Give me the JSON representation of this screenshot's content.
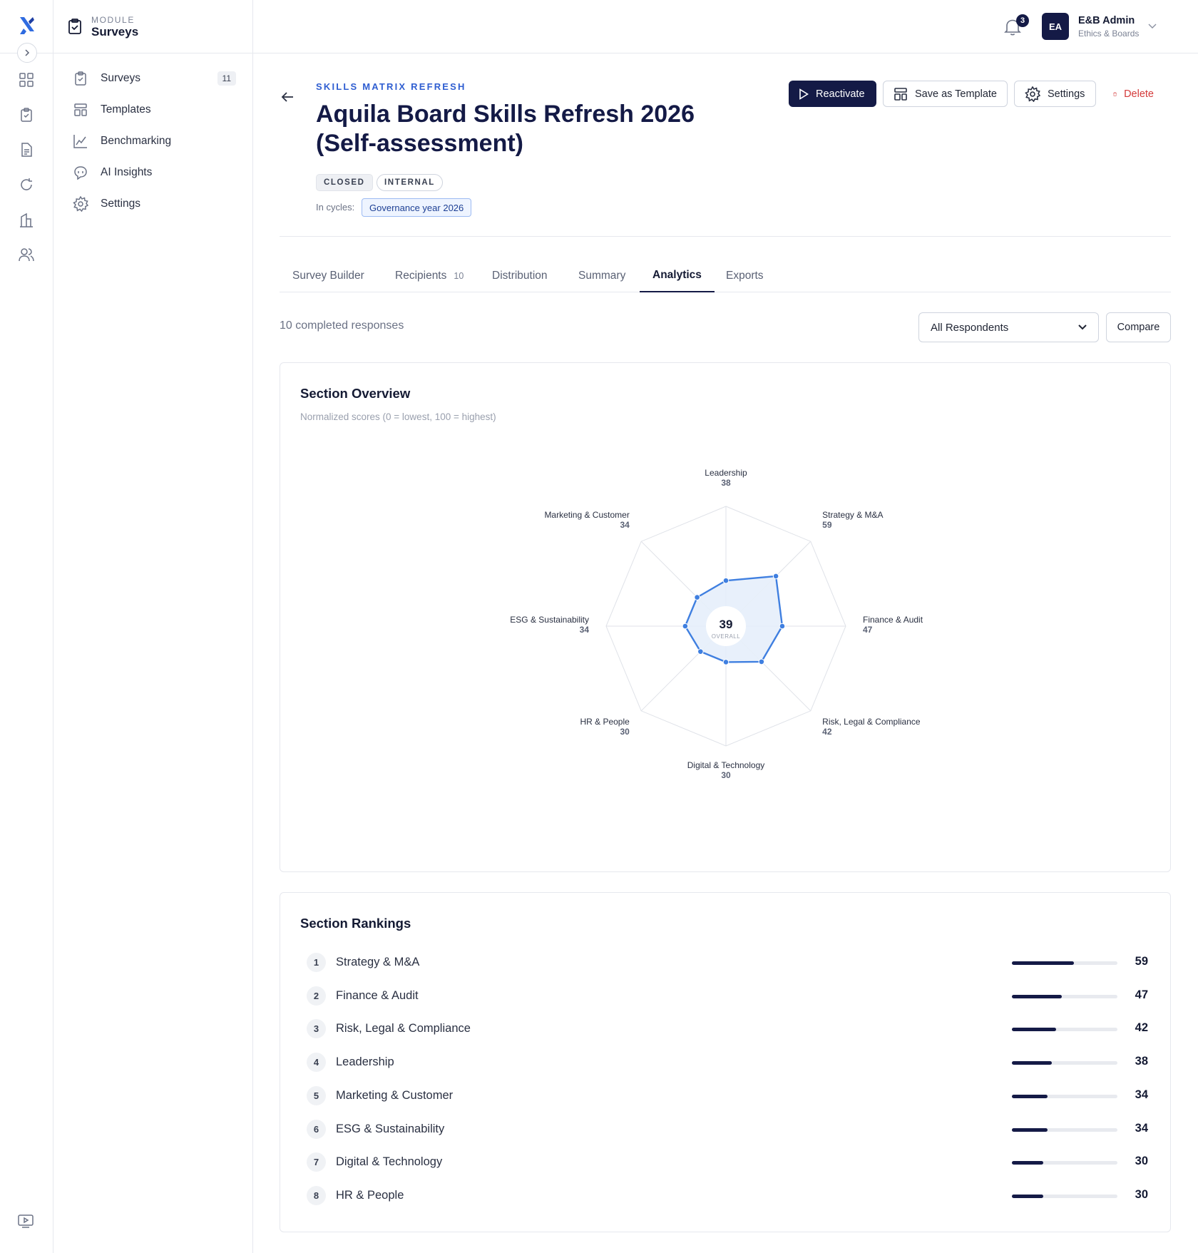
{
  "module": {
    "label": "MODULE",
    "title": "Surveys"
  },
  "rail": {
    "icons": [
      "logo-icon",
      "grid-icon",
      "clipboard-icon",
      "document-icon",
      "refresh-icon",
      "building-icon",
      "users-icon",
      "video-icon"
    ]
  },
  "sidebar": {
    "items": [
      {
        "label": "Surveys",
        "badge": "11",
        "icon": "clipboard-icon"
      },
      {
        "label": "Templates",
        "icon": "template-icon"
      },
      {
        "label": "Benchmarking",
        "icon": "chart-icon"
      },
      {
        "label": "AI Insights",
        "icon": "ai-icon"
      },
      {
        "label": "Settings",
        "icon": "gear-icon"
      }
    ]
  },
  "header": {
    "notifications": "3",
    "user": {
      "initials": "EA",
      "name": "E&B Admin",
      "org": "Ethics & Boards"
    }
  },
  "survey": {
    "eyebrow": "SKILLS MATRIX REFRESH",
    "title": "Aquila Board Skills Refresh 2026 (Self-assessment)",
    "status": "CLOSED",
    "visibility": "INTERNAL",
    "cycles_label": "In cycles:",
    "cycle": "Governance year 2026"
  },
  "actions": {
    "reactivate": "Reactivate",
    "save_template": "Save as Template",
    "settings": "Settings",
    "delete": "Delete"
  },
  "tabs": [
    {
      "label": "Survey Builder"
    },
    {
      "label": "Recipients",
      "count": "10"
    },
    {
      "label": "Distribution"
    },
    {
      "label": "Summary"
    },
    {
      "label": "Analytics",
      "active": true
    },
    {
      "label": "Exports"
    }
  ],
  "analytics": {
    "responses": "10 completed responses",
    "filter": "All Respondents",
    "compare": "Compare"
  },
  "overview": {
    "title": "Section Overview",
    "subtitle": "Normalized scores (0 = lowest, 100 = highest)",
    "overall_value": "39",
    "overall_label": "OVERALL"
  },
  "chart_data": {
    "type": "radar",
    "title": "Section Overview",
    "range": [
      0,
      100
    ],
    "categories": [
      "Leadership",
      "Strategy & M&A",
      "Finance & Audit",
      "Risk, Legal & Compliance",
      "Digital & Technology",
      "HR & People",
      "ESG & Sustainability",
      "Marketing & Customer"
    ],
    "values": [
      38,
      59,
      47,
      42,
      30,
      30,
      34,
      34
    ],
    "overall": 39,
    "colors": {
      "line": "#3f7fe0",
      "fill": "#e6eefb",
      "grid": "#dfe2e8"
    }
  },
  "rankings": {
    "title": "Section Rankings",
    "rows": [
      {
        "rank": "1",
        "name": "Strategy & M&A",
        "value": "59"
      },
      {
        "rank": "2",
        "name": "Finance & Audit",
        "value": "47"
      },
      {
        "rank": "3",
        "name": "Risk, Legal & Compliance",
        "value": "42"
      },
      {
        "rank": "4",
        "name": "Leadership",
        "value": "38"
      },
      {
        "rank": "5",
        "name": "Marketing & Customer",
        "value": "34"
      },
      {
        "rank": "6",
        "name": "ESG & Sustainability",
        "value": "34"
      },
      {
        "rank": "7",
        "name": "Digital & Technology",
        "value": "30"
      },
      {
        "rank": "8",
        "name": "HR & People",
        "value": "30"
      }
    ]
  }
}
